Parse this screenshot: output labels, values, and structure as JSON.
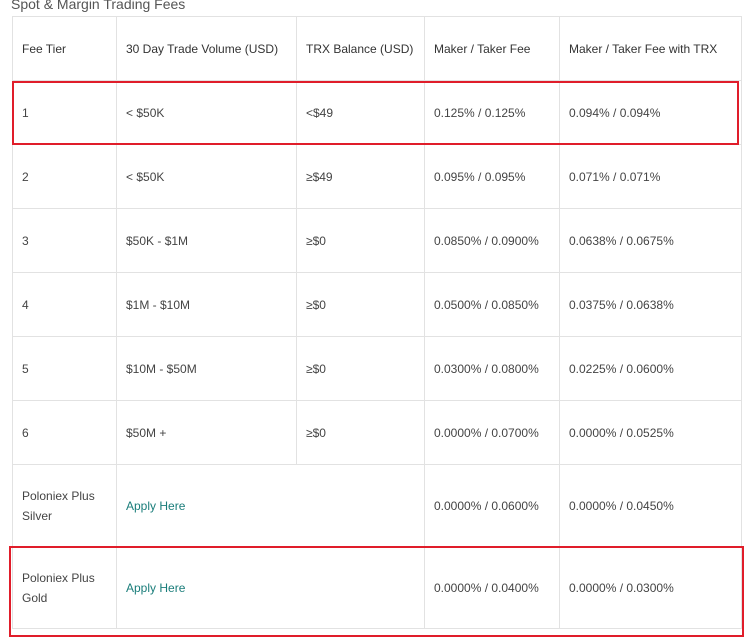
{
  "title": "Spot & Margin Trading Fees",
  "headers": [
    "Fee Tier",
    "30 Day Trade Volume (USD)",
    "TRX Balance (USD)",
    "Maker / Taker Fee",
    "Maker / Taker Fee with TRX"
  ],
  "rows": [
    {
      "tier": "1",
      "volume": "< $50K",
      "trx": "<$49",
      "fee": "0.125% / 0.125%",
      "fee_trx": "0.094% / 0.094%"
    },
    {
      "tier": "2",
      "volume": "< $50K",
      "trx": "≥$49",
      "fee": "0.095% / 0.095%",
      "fee_trx": "0.071% / 0.071%"
    },
    {
      "tier": "3",
      "volume": "$50K - $1M",
      "trx": "≥$0",
      "fee": "0.0850% / 0.0900%",
      "fee_trx": "0.0638% / 0.0675%"
    },
    {
      "tier": "4",
      "volume": "$1M - $10M",
      "trx": "≥$0",
      "fee": "0.0500% / 0.0850%",
      "fee_trx": "0.0375% / 0.0638%"
    },
    {
      "tier": "5",
      "volume": "$10M - $50M",
      "trx": "≥$0",
      "fee": "0.0300% / 0.0800%",
      "fee_trx": "0.0225% / 0.0600%"
    },
    {
      "tier": "6",
      "volume": "$50M +",
      "trx": "≥$0",
      "fee": "0.0000% / 0.0700%",
      "fee_trx": "0.0000% / 0.0525%"
    }
  ],
  "plus_rows": [
    {
      "tier": "Poloniex Plus Silver",
      "link": "Apply Here",
      "fee": "0.0000% / 0.0600%",
      "fee_trx": "0.0000% / 0.0450%"
    },
    {
      "tier": "Poloniex Plus Gold",
      "link": "Apply Here",
      "fee": "0.0000% / 0.0400%",
      "fee_trx": "0.0000% / 0.0300%"
    }
  ],
  "colors": {
    "highlight": "#e01d2a",
    "link": "#1a7d7a",
    "border": "#e2e2e2"
  }
}
